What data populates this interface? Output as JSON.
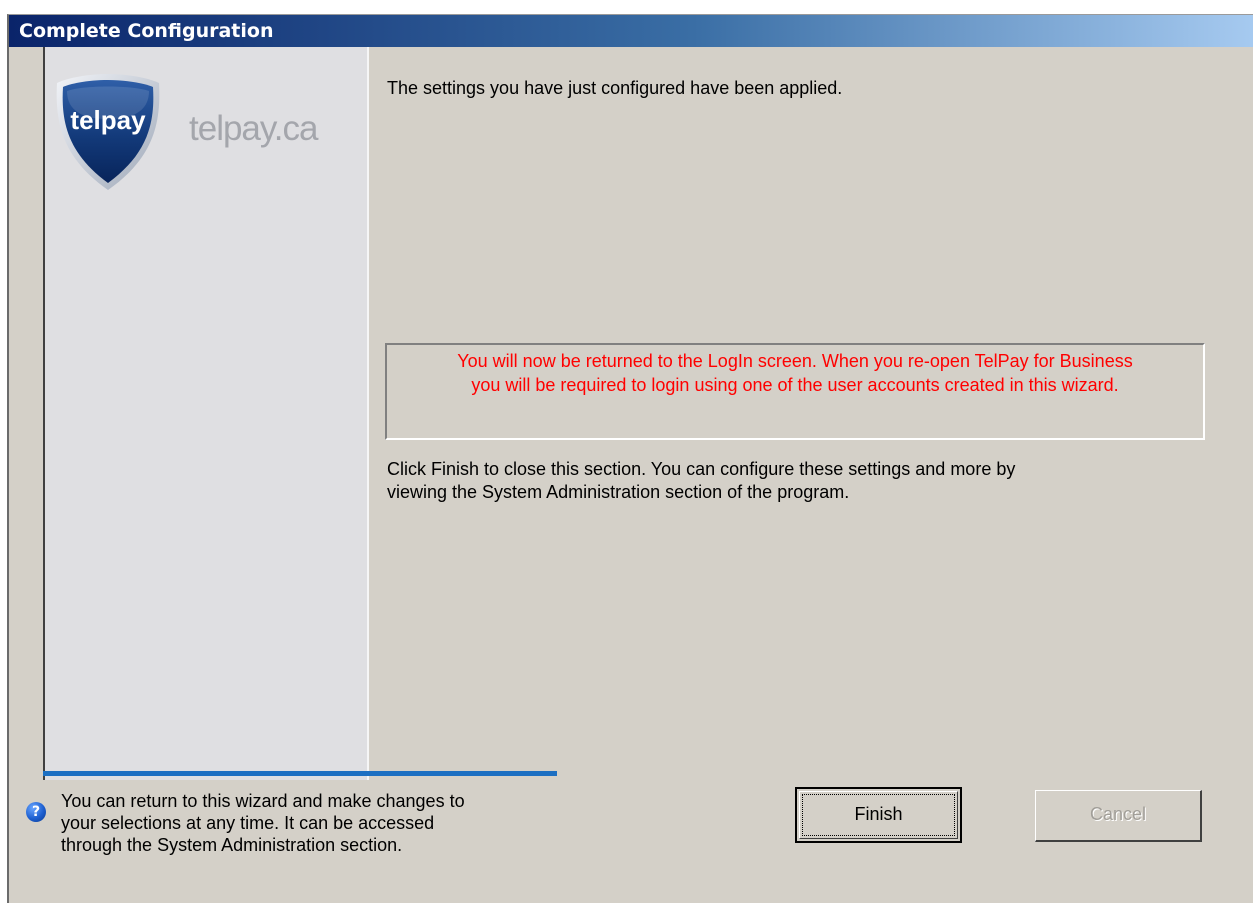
{
  "window": {
    "title": "Complete Configuration"
  },
  "branding": {
    "logo_text": "telpay",
    "site_text": "telpay.ca",
    "logo_icon": "shield-logo-icon"
  },
  "main": {
    "applied_text": "The settings you have just configured have been applied.",
    "notice_line1": "You will now be returned to the LogIn screen.  When you re-open TelPay for Business",
    "notice_line2": "you will be required to login using one of the user accounts created in this wizard.",
    "click_line1": "Click Finish to close this section.  You can configure these settings and more by",
    "click_line2": "viewing the System Administration section of the program."
  },
  "footer": {
    "help_icon": "question-help-icon",
    "help_line1": "You can return to this wizard and make changes to",
    "help_line2": "your selections at any time.  It can be accessed",
    "help_line3": "through the System Administration section."
  },
  "buttons": {
    "finish_label": "Finish",
    "cancel_label": "Cancel"
  },
  "colors": {
    "title_bar_start": "#0a246a",
    "title_bar_end": "#a6caf0",
    "notice_text": "#ff0000",
    "separator": "#1c6fc2",
    "dialog_background": "#d4d0c8"
  }
}
